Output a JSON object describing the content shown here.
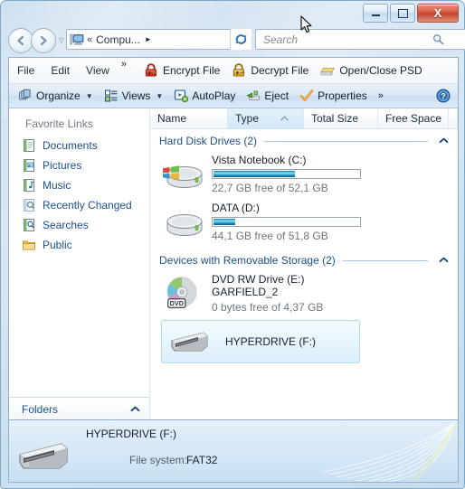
{
  "window": {
    "minimize_label": "Minimize",
    "maximize_label": "Maximize",
    "close_label": "X"
  },
  "navigation": {
    "back_label": "◄",
    "forward_label": "►",
    "history_label": "▽",
    "breadcrumb_chevrons": "«",
    "breadcrumb_text": "Compu...",
    "breadcrumb_arrow": "►",
    "address_dropdown": "▼",
    "refresh_icon": "refresh-icon"
  },
  "search": {
    "placeholder": "Search"
  },
  "menu": {
    "items": [
      {
        "label": "File"
      },
      {
        "label": "Edit"
      },
      {
        "label": "View"
      }
    ],
    "overflow": "»",
    "tools": [
      {
        "label": "Encrypt File",
        "icon": "red-padlock-icon"
      },
      {
        "label": "Decrypt File",
        "icon": "gold-padlock-icon"
      },
      {
        "label": "Open/Close PSD",
        "icon": "yellow-drive-icon"
      }
    ]
  },
  "command_bar": {
    "organize_label": "Organize",
    "views_label": "Views",
    "autoplay_label": "AutoPlay",
    "eject_label": "Eject",
    "properties_label": "Properties",
    "overflow": "»",
    "caret": "▼",
    "help_label": "?"
  },
  "sidebar": {
    "header": "Favorite Links",
    "items": [
      {
        "label": "Documents",
        "icon": "documents-icon"
      },
      {
        "label": "Pictures",
        "icon": "pictures-icon"
      },
      {
        "label": "Music",
        "icon": "music-icon"
      },
      {
        "label": "Recently Changed",
        "icon": "recently-changed-icon"
      },
      {
        "label": "Searches",
        "icon": "searches-icon"
      },
      {
        "label": "Public",
        "icon": "public-folder-icon"
      }
    ],
    "folders_label": "Folders",
    "folders_chevron": "︿"
  },
  "columns": [
    {
      "label": "Name"
    },
    {
      "label": "Type",
      "sorted": true,
      "sort_arrow": "▲"
    },
    {
      "label": "Total Size"
    },
    {
      "label": "Free Space"
    }
  ],
  "groups": [
    {
      "title": "Hard Disk Drives (2)",
      "chevron": "︿",
      "drives": [
        {
          "name": "Vista Notebook (C:)",
          "sub": "22,7 GB free of 52,1 GB",
          "used_percent": 56,
          "icon": "system-drive-icon",
          "has_bar": true
        },
        {
          "name": "DATA (D:)",
          "sub": "44,1 GB free of 51,8 GB",
          "used_percent": 15,
          "icon": "hard-drive-icon",
          "has_bar": true
        }
      ]
    },
    {
      "title": "Devices with Removable Storage (2)",
      "chevron": "︿",
      "drives": [
        {
          "name": "DVD RW Drive (E:)",
          "volume": "GARFIELD_2",
          "sub": "0 bytes free of 4,37 GB",
          "icon": "dvd-drive-icon",
          "badge": "DVD",
          "has_bar": false
        }
      ]
    }
  ],
  "selected_drive": {
    "name": "HYPERDRIVE (F:)",
    "icon": "usb-drive-icon"
  },
  "details": {
    "title": "HYPERDRIVE (F:)",
    "file_system_label": "File system:",
    "file_system_value": "FAT32",
    "icon": "usb-drive-icon"
  },
  "colors": {
    "accent_blue": "#1d4f8c",
    "link_blue": "#1b4f8f",
    "close_red": "#c2402c",
    "bar_fill": "#2ea7d8",
    "selection": "#e7f4fd"
  }
}
